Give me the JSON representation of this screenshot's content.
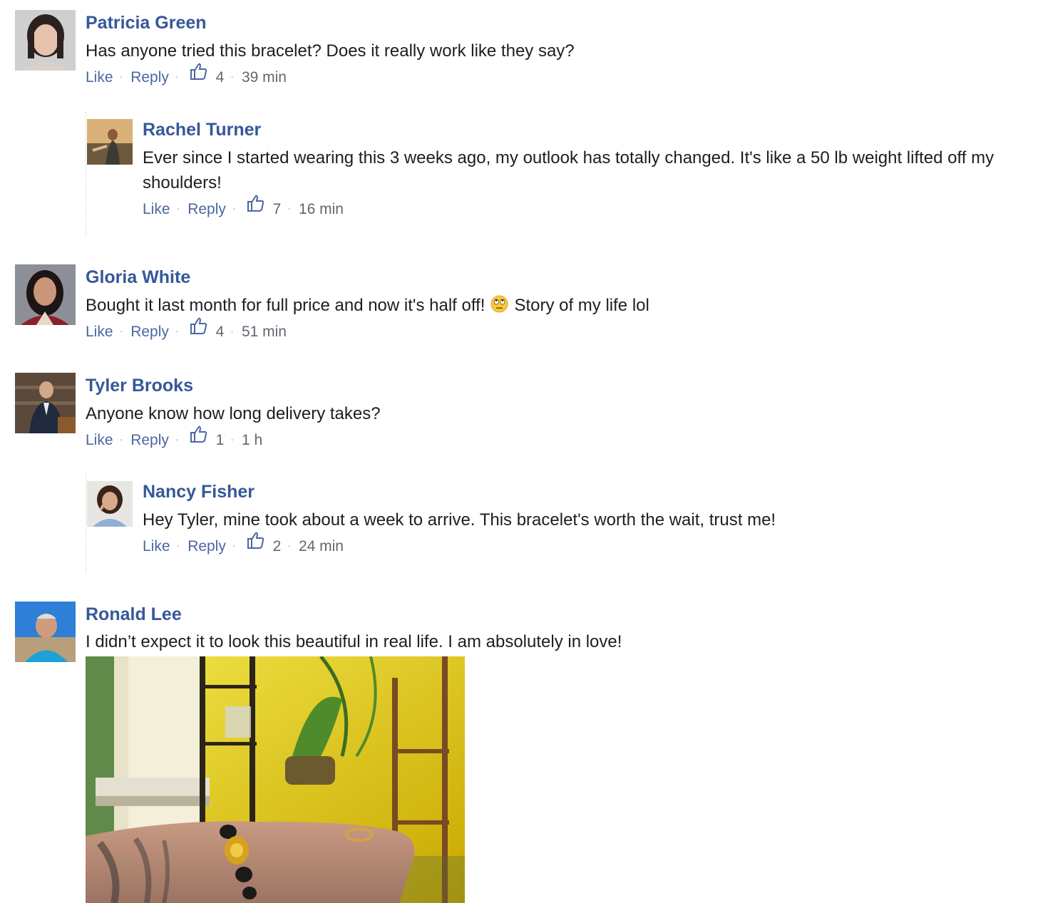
{
  "comments": [
    {
      "author": "Patricia Green",
      "text": "Has anyone tried this bracelet? Does it really work like they say?",
      "like_label": "Like",
      "reply_label": "Reply",
      "likes": "4",
      "time": "39 min",
      "replies": [
        {
          "author": "Rachel Turner",
          "text": "Ever since I started wearing this 3 weeks ago, my outlook has totally changed. It's like a 50 lb weight lifted off my shoulders!",
          "like_label": "Like",
          "reply_label": "Reply",
          "likes": "7",
          "time": "16 min"
        }
      ]
    },
    {
      "author": "Gloria White",
      "text_before_emoji": "Bought it last month for full price and now it's half off!",
      "emoji": "face-with-rolling-eyes",
      "text_after_emoji": "Story of my life lol",
      "like_label": "Like",
      "reply_label": "Reply",
      "likes": "4",
      "time": "51 min"
    },
    {
      "author": "Tyler Brooks",
      "text": "Anyone know how long delivery takes?",
      "like_label": "Like",
      "reply_label": "Reply",
      "likes": "1",
      "time": "1 h",
      "replies": [
        {
          "author": "Nancy Fisher",
          "text": "Hey Tyler, mine took about a week to arrive. This bracelet's worth the wait, trust me!",
          "like_label": "Like",
          "reply_label": "Reply",
          "likes": "2",
          "time": "24 min"
        }
      ]
    },
    {
      "author": "Ronald Lee",
      "text": "I didn’t expect it to look this beautiful in real life. I am absolutely in love!",
      "attachment": "photo-bracelet-on-wrist"
    }
  ],
  "colors": {
    "author": "#365899",
    "link": "#4b67a1",
    "text": "#1c1e21",
    "meta": "#606770"
  },
  "icons": [
    "thumbs-up-icon",
    "face-with-rolling-eyes-emoji"
  ]
}
